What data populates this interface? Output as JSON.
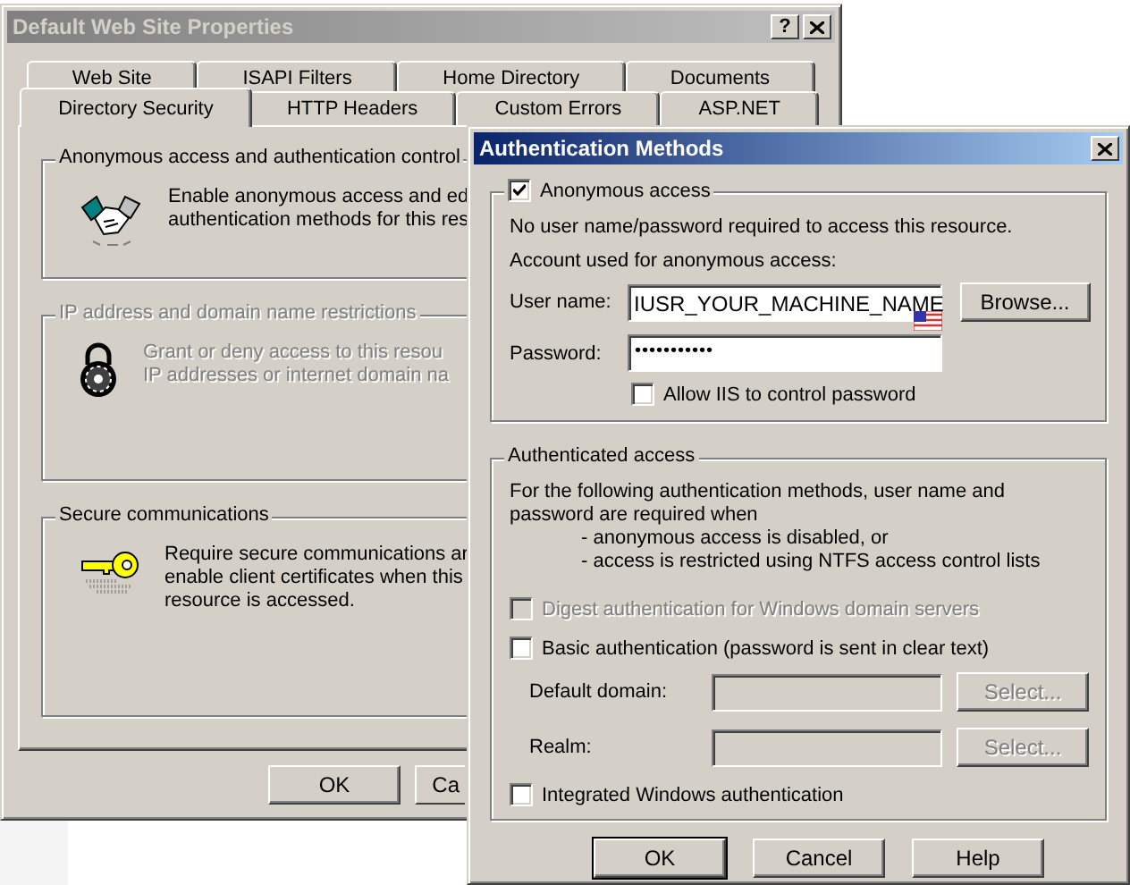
{
  "back_window": {
    "title": "Default Web Site Properties",
    "help_button": "?",
    "tabs_row_1": [
      {
        "label": "Web Site",
        "selected": false
      },
      {
        "label": "ISAPI Filters",
        "selected": false
      },
      {
        "label": "Home Directory",
        "selected": false
      },
      {
        "label": "Documents",
        "selected": false
      }
    ],
    "tabs_row_2": [
      {
        "label": "Directory Security",
        "selected": true
      },
      {
        "label": "HTTP Headers",
        "selected": false
      },
      {
        "label": "Custom Errors",
        "selected": false
      },
      {
        "label": "ASP.NET",
        "selected": false
      }
    ],
    "groups": [
      {
        "title": "Anonymous access and authentication control",
        "disabled": false,
        "lines": [
          "Enable anonymous access and ed",
          "authentication methods for this res"
        ]
      },
      {
        "title": "IP address and domain name restrictions",
        "disabled": true,
        "lines": [
          "Grant or deny access to this resou",
          "IP addresses or internet domain na"
        ]
      },
      {
        "title": "Secure communications",
        "disabled": false,
        "lines": [
          "Require secure communications ar",
          "enable client certificates when this",
          "resource is accessed."
        ]
      }
    ],
    "buttons": [
      "OK",
      "Ca"
    ]
  },
  "auth_window": {
    "title": "Authentication Methods",
    "anonymous": {
      "label": "Anonymous access",
      "checked": true,
      "note": "No user name/password required to access this resource.",
      "account_caption": "Account used for anonymous access:",
      "user_name": {
        "label": "User name:",
        "value": "IUSR_YOUR_MACHINE_NAME"
      },
      "browse_button": "Browse...",
      "password": {
        "label": "Password:",
        "value": "•••••••••••"
      },
      "allow_iis": {
        "label": "Allow IIS to control password",
        "checked": false
      }
    },
    "authenticated": {
      "title": "Authenticated access",
      "intro": "For the following authentication methods, user name and password are required when",
      "conditions": [
        "- anonymous access is disabled, or",
        "- access is restricted using NTFS access control lists"
      ],
      "options": [
        {
          "kind": "checkbox",
          "label": "Digest authentication for Windows domain servers",
          "checked": false,
          "disabled": true
        },
        {
          "kind": "checkbox",
          "label": "Basic authentication (password is sent in clear text)",
          "checked": false,
          "disabled": false
        },
        {
          "kind": "field",
          "label": "Default domain:",
          "button": "Select...",
          "disabled": true
        },
        {
          "kind": "field",
          "label": "Realm:",
          "button": "Select...",
          "disabled": true
        },
        {
          "kind": "checkbox",
          "label": "Integrated Windows authentication",
          "checked": false,
          "disabled": false
        }
      ]
    },
    "buttons": [
      {
        "label": "OK",
        "default": true
      },
      {
        "label": "Cancel",
        "default": false
      },
      {
        "label": "Help",
        "default": false
      }
    ]
  }
}
